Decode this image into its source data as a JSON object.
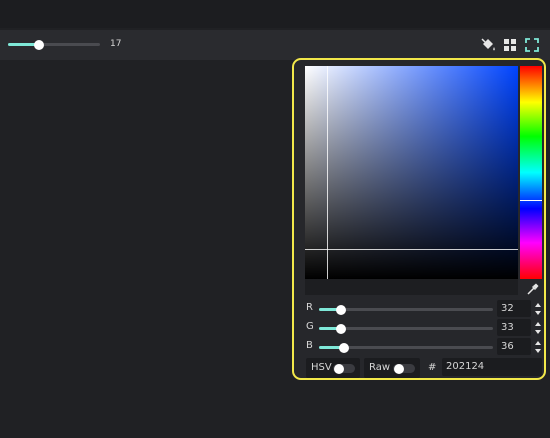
{
  "toolbar": {
    "brush_size": {
      "value_label": "17",
      "value": 17,
      "fill_fraction": 0.34
    },
    "icons": [
      "paint-bucket-icon",
      "grid-icon",
      "fullscreen-icon"
    ]
  },
  "color_picker": {
    "hue_marker_fraction": 0.63,
    "eyedropper_icon": "eyedropper-icon",
    "channels": [
      {
        "label": "R",
        "value": "32",
        "fraction": 0.125
      },
      {
        "label": "G",
        "value": "33",
        "fraction": 0.129
      },
      {
        "label": "B",
        "value": "36",
        "fraction": 0.141
      }
    ],
    "hsv_label": "HSV",
    "raw_label": "Raw",
    "hash_label": "#",
    "hex_value": "202124",
    "colors": {
      "accent": "#7fe8d8",
      "border": "#f2e84a",
      "panel": "#26272b",
      "background": "#202124"
    }
  }
}
